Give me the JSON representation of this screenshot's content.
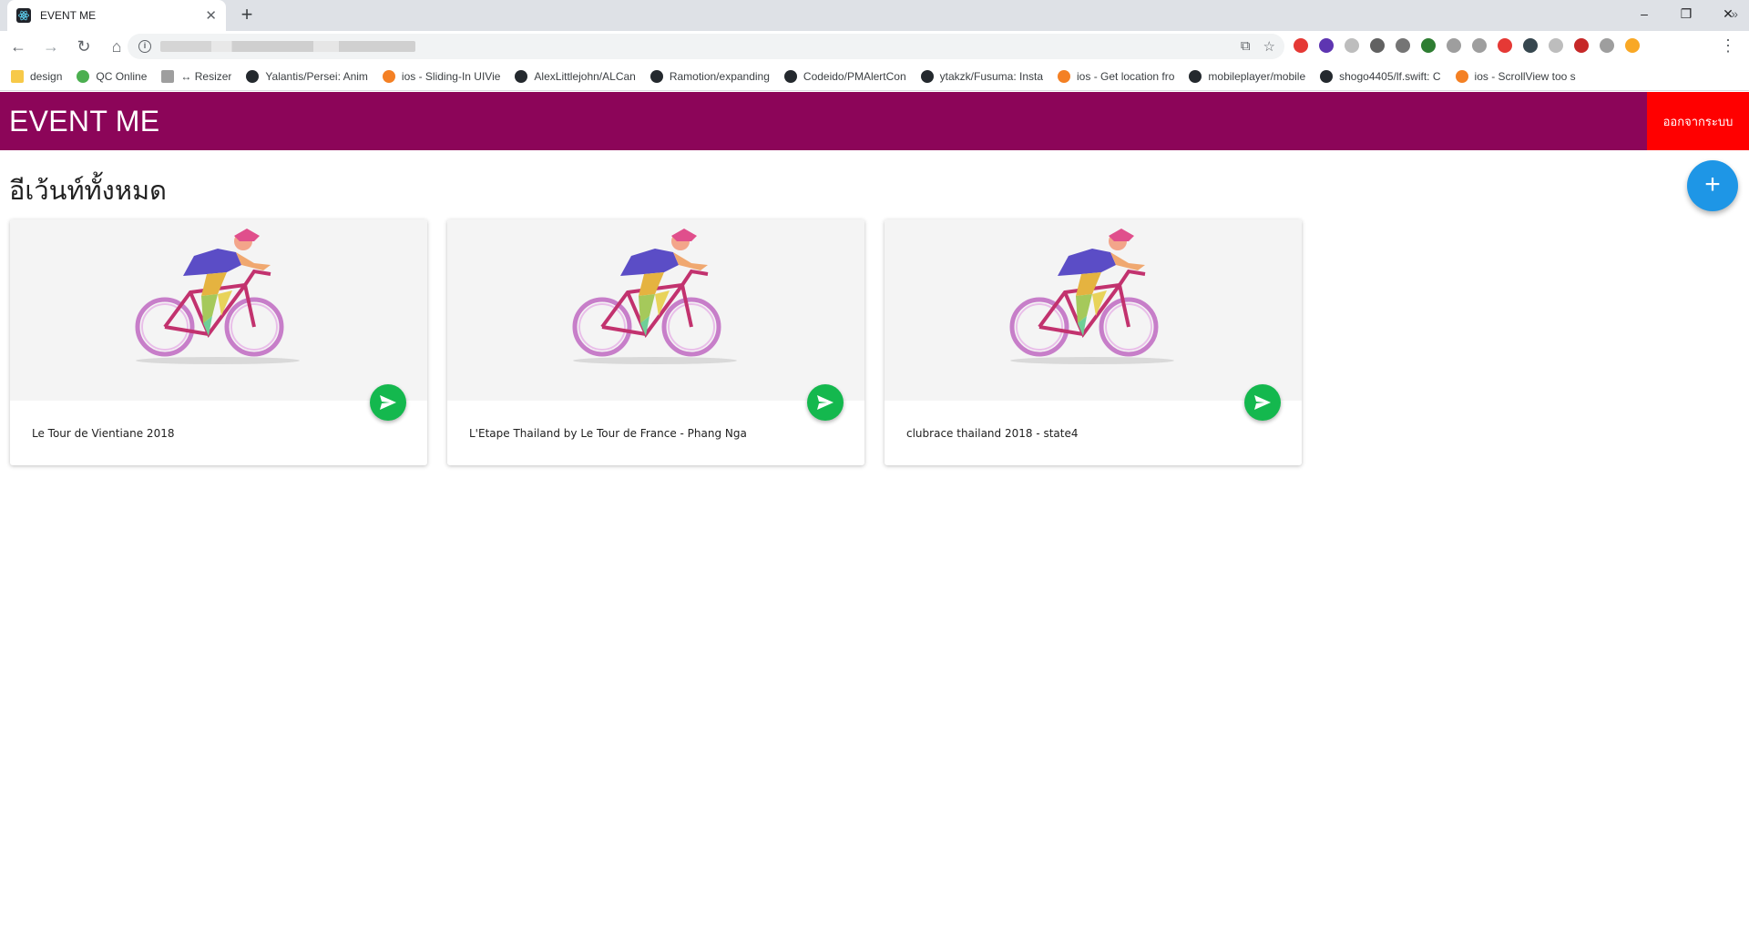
{
  "browser": {
    "tab_title": "EVENT ME",
    "new_tab_symbol": "+",
    "window_controls": [
      "–",
      "❐",
      "✕"
    ],
    "bookmarks": [
      {
        "label": "design",
        "icon": "folder-icon",
        "color": "#f7c948"
      },
      {
        "label": "QC Online",
        "icon": "check-icon",
        "color": "#4caf50"
      },
      {
        "label": "↔ Resizer",
        "icon": "page-icon",
        "color": "#9e9e9e"
      },
      {
        "label": "Yalantis/Persei: Anim",
        "icon": "github-icon",
        "color": "#24292e"
      },
      {
        "label": "ios - Sliding-In UIVie",
        "icon": "stackoverflow-icon",
        "color": "#f48024"
      },
      {
        "label": "AlexLittlejohn/ALCan",
        "icon": "github-icon",
        "color": "#24292e"
      },
      {
        "label": "Ramotion/expanding",
        "icon": "github-icon",
        "color": "#24292e"
      },
      {
        "label": "Codeido/PMAlertCon",
        "icon": "github-icon",
        "color": "#24292e"
      },
      {
        "label": "ytakzk/Fusuma: Insta",
        "icon": "github-icon",
        "color": "#24292e"
      },
      {
        "label": "ios - Get location fro",
        "icon": "stackoverflow-icon",
        "color": "#f48024"
      },
      {
        "label": "mobileplayer/mobile",
        "icon": "github-icon",
        "color": "#24292e"
      },
      {
        "label": "shogo4405/lf.swift: C",
        "icon": "github-icon",
        "color": "#24292e"
      },
      {
        "label": "ios - ScrollView too s",
        "icon": "stackoverflow-icon",
        "color": "#f48024"
      }
    ],
    "extension_colors": [
      "#e53935",
      "#5e35b1",
      "#bdbdbd",
      "#616161",
      "#757575",
      "#2e7d32",
      "#9e9e9e",
      "#9e9e9e",
      "#e53935",
      "#37474f",
      "#bdbdbd",
      "#c62828",
      "#9e9e9e",
      "#f9a825"
    ]
  },
  "app": {
    "title": "EVENT ME",
    "logout_label": "ออกจากระบบ",
    "section_title": "อีเว้นท์ทั้งหมด",
    "fab_label": "+",
    "accent_color": "#8c0559",
    "events": [
      {
        "title": "Le Tour de Vientiane 2018"
      },
      {
        "title": "L'Etape Thailand by Le Tour de France - Phang Nga"
      },
      {
        "title": "clubrace thailand 2018 - state4"
      }
    ]
  }
}
